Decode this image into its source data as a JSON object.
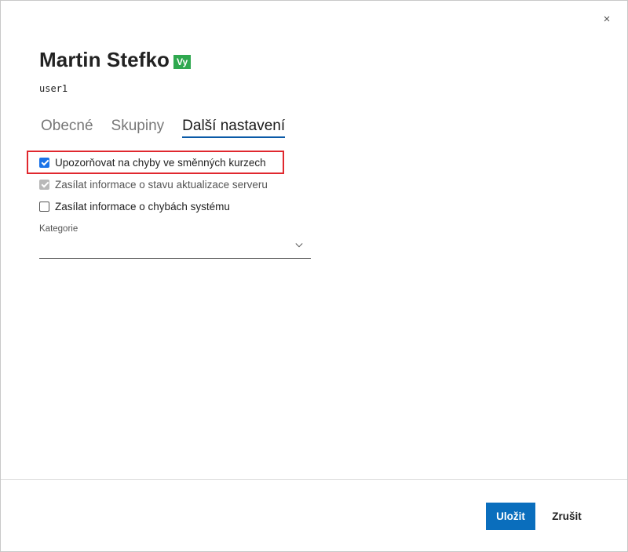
{
  "dialog": {
    "close_glyph": "×",
    "user_name": "Martin Stefko",
    "you_badge": "Vy",
    "user_login": "user1"
  },
  "tabs": [
    {
      "label": "Obecné",
      "active": false
    },
    {
      "label": "Skupiny",
      "active": false
    },
    {
      "label": "Další nastavení",
      "active": true
    }
  ],
  "options": [
    {
      "label": "Upozorňovat na chyby ve směnných kurzech",
      "checked": true,
      "disabled": false
    },
    {
      "label": "Zasílat informace o stavu aktualizace serveru",
      "checked": true,
      "disabled": true
    },
    {
      "label": "Zasílat informace o chybách systému",
      "checked": false,
      "disabled": false
    }
  ],
  "category": {
    "label": "Kategorie",
    "selected_value": ""
  },
  "footer": {
    "save_label": "Uložit",
    "cancel_label": "Zrušit"
  },
  "colors": {
    "accent": "#0a6ebd",
    "badge": "#2fa84f",
    "highlight": "#e0282e"
  },
  "icons": {
    "close": "close-icon",
    "dropdown": "chevron-down-icon"
  }
}
